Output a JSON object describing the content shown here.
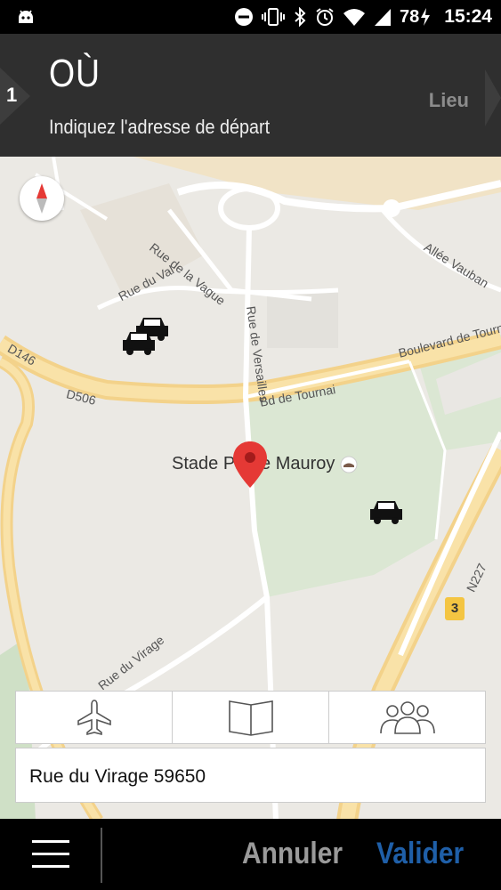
{
  "status_bar": {
    "battery_level": "78",
    "time": "15:24",
    "icons": [
      "android-icon",
      "do-not-disturb-icon",
      "vibrate-icon",
      "bluetooth-icon",
      "alarm-icon",
      "wifi-icon",
      "signal-icon",
      "charging-icon"
    ]
  },
  "header": {
    "step_number": "1",
    "title": "OÙ",
    "subtitle": "Indiquez l'adresse de départ",
    "next_step_label": "Lieu"
  },
  "map": {
    "street_labels": {
      "rue_de_la_vague": "Rue de la Vague",
      "rue_du_val": "Rue du Val",
      "allee_vauban": "Allée Vauban",
      "rue_de_versailles": "Rue de Versailles",
      "boulevard_de_tournai": "Boulevard de Tournai",
      "d146": "D146",
      "d506": "D506",
      "bd_de_tournai": "Bd de Tournai",
      "n227": "N227",
      "rue_du_virage": "Rue du Virage"
    },
    "poi_label": "Stade Pierre Mauroy",
    "route_badge": "3"
  },
  "panel": {
    "tabs": [
      "airplane-icon",
      "book-icon",
      "group-icon"
    ],
    "address_value": "Rue du Virage 59650"
  },
  "footer": {
    "cancel_label": "Annuler",
    "validate_label": "Valider"
  },
  "colors": {
    "header_bg": "#2f2f2f",
    "validate_blue": "#1f5fa8",
    "cancel_gray": "#9a9a9a",
    "pin_red": "#e53935",
    "park_green": "#dbe7d3",
    "road_yellow": "#f7d98b"
  }
}
